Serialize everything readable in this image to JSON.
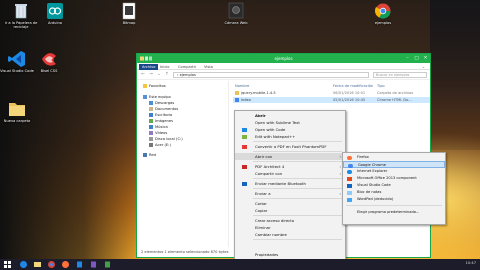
{
  "desktop_icons": [
    {
      "label": "Ir a la Papelera de reciclaje",
      "icon": "recycle-bin-icon"
    },
    {
      "label": "Arduino",
      "icon": "arduino-icon"
    },
    {
      "label": "Bitmap",
      "icon": "bitmap-file-icon"
    },
    {
      "label": "Cámara Web",
      "icon": "webcam-shortcut-icon"
    },
    {
      "label": "ejemplos",
      "icon": "chrome-icon"
    },
    {
      "label": "Visual Studio Code",
      "icon": "vscode-icon"
    },
    {
      "label": "Bisel CSS",
      "icon": "css-icon"
    },
    {
      "label": "Nueva carpeta",
      "icon": "folder-icon"
    }
  ],
  "explorer": {
    "title": "ejemplos",
    "ribbon_tabs": [
      "Archivo",
      "Inicio",
      "Compartir",
      "Vista"
    ],
    "address": "› ejemplos",
    "search_placeholder": "Buscar en ejemplos",
    "nav": {
      "favorites": "Favoritos",
      "this_pc": "Este equipo",
      "items": [
        "Descargas",
        "Documentos",
        "Escritorio",
        "Imágenes",
        "Música",
        "Vídeos",
        "Disco local (C:)",
        "Acer (E:)"
      ],
      "network": "Red"
    },
    "columns": [
      "Nombre",
      "Fecha de modificación",
      "Tipo"
    ],
    "files": [
      {
        "name": "jquery.mobile-1.4.5",
        "date": "06/01/2016 10:01",
        "type": "Carpeta de archivos"
      },
      {
        "name": "index",
        "date": "05/01/2016 10:45",
        "type": "Chrome HTML Do..."
      }
    ],
    "status": "2 elementos   1 elemento seleccionado  870 bytes"
  },
  "context_menu": {
    "items": [
      {
        "label": "Abrir",
        "bold": true
      },
      {
        "label": "Open with Sublime Text"
      },
      {
        "label": "Open with Code"
      },
      {
        "label": "Edit with Notepad++"
      },
      {
        "label": "Convertir a PDF en Foxit PhantomPDF"
      },
      {
        "label": "Abrir con",
        "submenu": true
      },
      {
        "label": "PDF Architect 4",
        "submenu": true
      },
      {
        "label": "Compartir con",
        "submenu": true
      },
      {
        "label": "Enviar mediante Bluetooth"
      },
      {
        "label": "Enviar a",
        "submenu": true
      },
      {
        "label": "Cortar"
      },
      {
        "label": "Copiar"
      },
      {
        "label": "Crear acceso directo"
      },
      {
        "label": "Eliminar"
      },
      {
        "label": "Cambiar nombre"
      },
      {
        "label": "Propiedades"
      }
    ]
  },
  "submenu": {
    "items": [
      {
        "label": "Firefox",
        "icon": "firefox-icon"
      },
      {
        "label": "Google Chrome",
        "icon": "chrome-icon"
      },
      {
        "label": "Internet Explorer",
        "icon": "ie-icon"
      },
      {
        "label": "Microsoft Office 2013 component",
        "icon": "office-icon"
      },
      {
        "label": "Visual Studio Code",
        "icon": "vscode-icon"
      },
      {
        "label": "Bloc de notas",
        "icon": "notepad-icon"
      },
      {
        "label": "WordPad (deducido)",
        "icon": "wordpad-icon"
      },
      {
        "label": "Elegir programa predeterminado...",
        "icon": ""
      }
    ]
  },
  "taskbar": {
    "tray_time": "10:47"
  },
  "colors": {
    "window_accent": "#22b14c",
    "file_tab": "#19478a",
    "taskbar": "#1c1c2a"
  }
}
